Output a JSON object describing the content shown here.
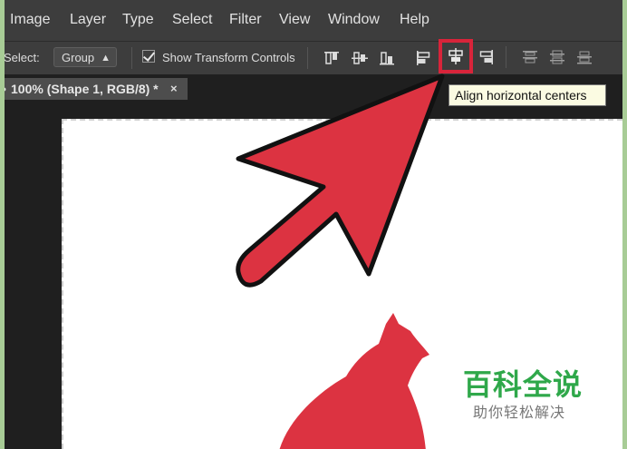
{
  "menu": {
    "items": [
      "Image",
      "Layer",
      "Type",
      "Select",
      "Filter",
      "View",
      "Window",
      "Help"
    ]
  },
  "options": {
    "select_label": "Select:",
    "select_value": "Group",
    "show_transform_label": "Show Transform Controls",
    "show_transform_checked": true
  },
  "document": {
    "tab_label": "100% (Shape 1, RGB/8) *",
    "close_glyph": "×"
  },
  "tooltip": {
    "text": "Align horizontal centers"
  },
  "watermark": {
    "title": "百科全说",
    "subtitle": "助你轻松解决"
  },
  "colors": {
    "highlight": "#d8243a",
    "arrow_fill": "#dc3341",
    "cat_fill": "#dc3341",
    "watermark_green": "#2fa84a"
  },
  "icons": {
    "align": [
      "align-top-edges-icon",
      "align-vertical-centers-icon",
      "align-bottom-edges-icon",
      "align-left-edges-icon",
      "align-horizontal-centers-icon",
      "align-right-edges-icon",
      "distribute-top-icon",
      "distribute-vertical-centers-icon",
      "distribute-bottom-icon"
    ]
  }
}
